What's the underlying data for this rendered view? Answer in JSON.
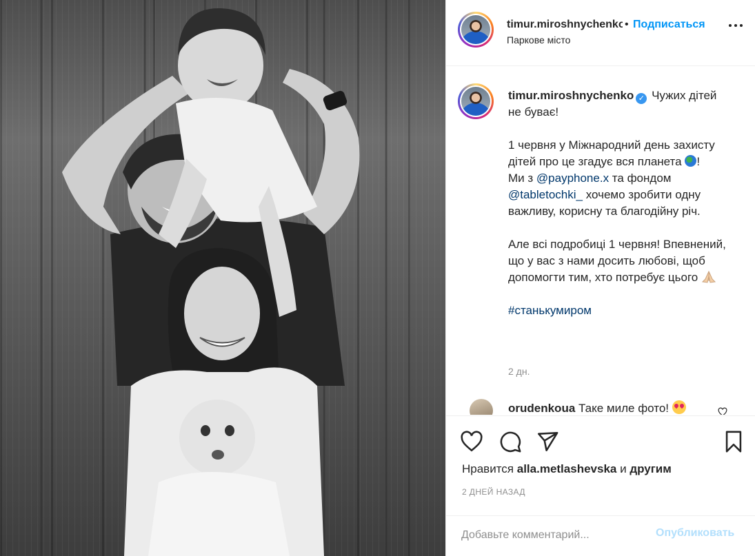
{
  "post": {
    "photo_alt": "",
    "header": {
      "username": "timur.miroshnychenko",
      "separator": "•",
      "follow_label": "Подписаться",
      "location": "Паркове місто",
      "more_icon": "more-horizontal-icon"
    },
    "caption": {
      "username": "timur.miroshnychenko",
      "verified_icon": "verified-badge-icon",
      "line1": "Чужих дітей не буває!",
      "p2_a": "1 червня у Міжнародний день захисту дітей про це згадує вся планета",
      "p2_globe_icon": "globe-emoji-icon",
      "p2_b": "!",
      "p3_a": "Ми з ",
      "mention1": "@payphone.x",
      "p3_b": " та фондом ",
      "mention2": "@tabletochki_",
      "p3_c": " хочемо зробити одну важливу, корисну та благодійну річ.",
      "p4": "Але всі подробиці 1 червня! Впевнений, що у вас з нами досить любові, щоб допомогти тим, хто потребує цього",
      "p4_pray_icon": "folded-hands-emoji-icon",
      "hashtag": "#станькумиром",
      "time": "2 дн."
    },
    "comment": {
      "username": "orudenkoua",
      "text": "Таке миле фото!",
      "emoji_icon": "heart-eyes-emoji-icon",
      "like_icon": "heart-outline-icon"
    },
    "actions": {
      "like_icon": "heart-icon",
      "comment_icon": "comment-icon",
      "share_icon": "share-icon",
      "save_icon": "bookmark-icon"
    },
    "likes": {
      "prefix": "Нравится ",
      "user": "alla.metlashevska",
      "middle": " и ",
      "others": "другим"
    },
    "date": "2 ДНЕЙ НАЗАД",
    "add_comment": {
      "placeholder": "Добавьте комментарий...",
      "publish_label": "Опубликовать"
    },
    "colors": {
      "link": "#00376b",
      "follow": "#0095f6",
      "publish_disabled": "#b2dffc",
      "muted": "#8e8e8e",
      "border": "#efefef"
    }
  }
}
